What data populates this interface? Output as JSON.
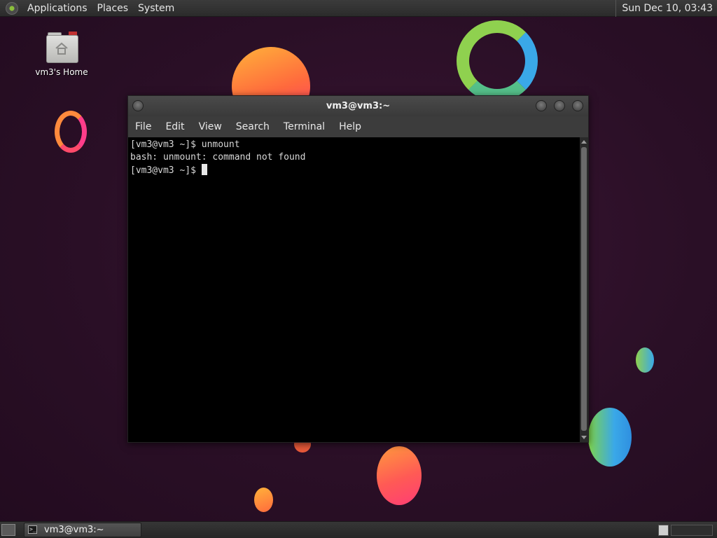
{
  "top_panel": {
    "menus": [
      "Applications",
      "Places",
      "System"
    ],
    "clock": "Sun Dec 10, 03:43"
  },
  "desktop": {
    "icon_label": "vm3's Home"
  },
  "terminal": {
    "title": "vm3@vm3:~",
    "menu": [
      "File",
      "Edit",
      "View",
      "Search",
      "Terminal",
      "Help"
    ],
    "lines": [
      "[vm3@vm3 ~]$ unmount",
      "bash: unmount: command not found"
    ],
    "prompt": "[vm3@vm3 ~]$ "
  },
  "taskbar": {
    "tasks": [
      {
        "label": "vm3@vm3:~",
        "icon": "terminal-icon"
      }
    ]
  },
  "colors": {
    "panel": "#2b2b2b",
    "desktop_bg": "#2a0f26",
    "terminal_bg": "#000000"
  }
}
